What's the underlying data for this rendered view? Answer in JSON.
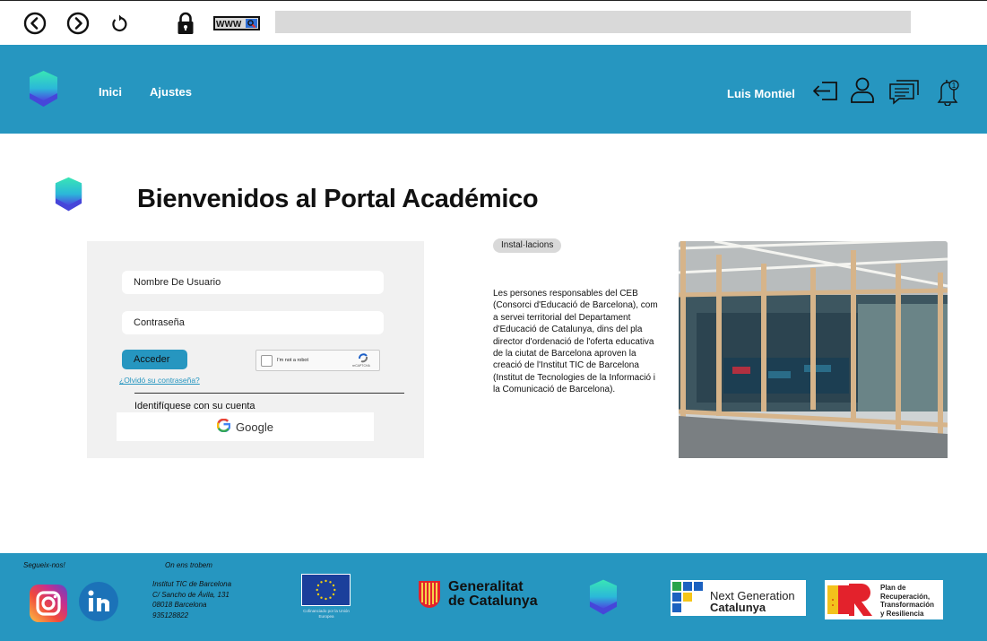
{
  "browser": {
    "back_icon": "back-arrow-circle-icon",
    "forward_icon": "forward-arrow-circle-icon",
    "reload_icon": "reload-icon",
    "lock_icon": "lock-icon",
    "www_label": "WWW",
    "url": ""
  },
  "header": {
    "nav": [
      {
        "label": "Inici"
      },
      {
        "label": "Ajustes"
      }
    ],
    "user_name": "Luis Montiel",
    "notification_count": "1"
  },
  "main": {
    "title": "Bienvenidos al Portal Académico",
    "login": {
      "username_placeholder": "Nombre De Usuario",
      "password_placeholder": "Contraseña",
      "submit_label": "Acceder",
      "captcha_label": "I'm not a robot",
      "captcha_brand": "reCAPTCHA",
      "forgot_label": "¿Olvidó su contraseña?",
      "identify_label": "Identifíquese  con su cuenta",
      "google_label": "Google"
    },
    "tag": "Instal·lacions",
    "description": "Les persones responsables del CEB (Consorci d'Educació de Barcelona), com a servei territorial del Departament d'Educació de Catalunya, dins del pla director d'ordenació de l'oferta educativa de la ciutat de Barcelona aproven la creació de l'Institut TIC de Barcelona (Institut de Tecnologies de la Informació i la Comunicació de Barcelona)."
  },
  "footer": {
    "follow_label": "Segueix-nos!",
    "find_label": "On ens trobem",
    "address_lines": [
      "Institut TIC de Barcelona",
      "C/ Sancho de Ávila, 131",
      "08018 Barcelona",
      "935128822"
    ],
    "eu_caption": "Cofinanciado por la Unión Europea",
    "gencat_line1": "Generalitat",
    "gencat_line2": "de Catalunya",
    "nextgen_line1": "Next Generation",
    "nextgen_line2": "Catalunya",
    "plan_lines": [
      "Plan de",
      "Recuperación,",
      "Transformación",
      "y Resiliencia"
    ]
  },
  "colors": {
    "brand_blue": "#2696c0",
    "logo_top": "#39e6b4",
    "logo_bottom": "#4a4ae0"
  }
}
